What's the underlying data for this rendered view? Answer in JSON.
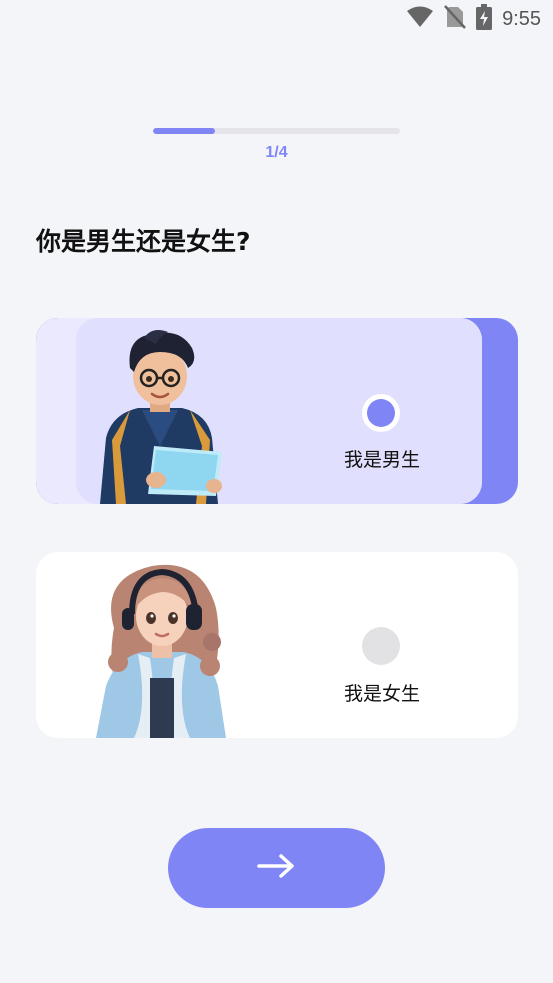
{
  "status_bar": {
    "time": "9:55",
    "icons": [
      "wifi-icon",
      "no-sim-icon",
      "battery-charging-icon"
    ]
  },
  "progress": {
    "label": "1/4",
    "fraction": 0.25,
    "accent_color": "#8085f6"
  },
  "question": {
    "text": "你是男生还是女生?"
  },
  "options": [
    {
      "label": "我是男生",
      "selected": true,
      "avatar": "boy-avatar"
    },
    {
      "label": "我是女生",
      "selected": false,
      "avatar": "girl-avatar"
    }
  ],
  "next_button": {
    "icon": "arrow-right-icon"
  },
  "colors": {
    "accent": "#8085f6",
    "background": "#f4f5f9",
    "selected_card": "#e0dffd",
    "unselected_radio": "#e2e2e4"
  }
}
